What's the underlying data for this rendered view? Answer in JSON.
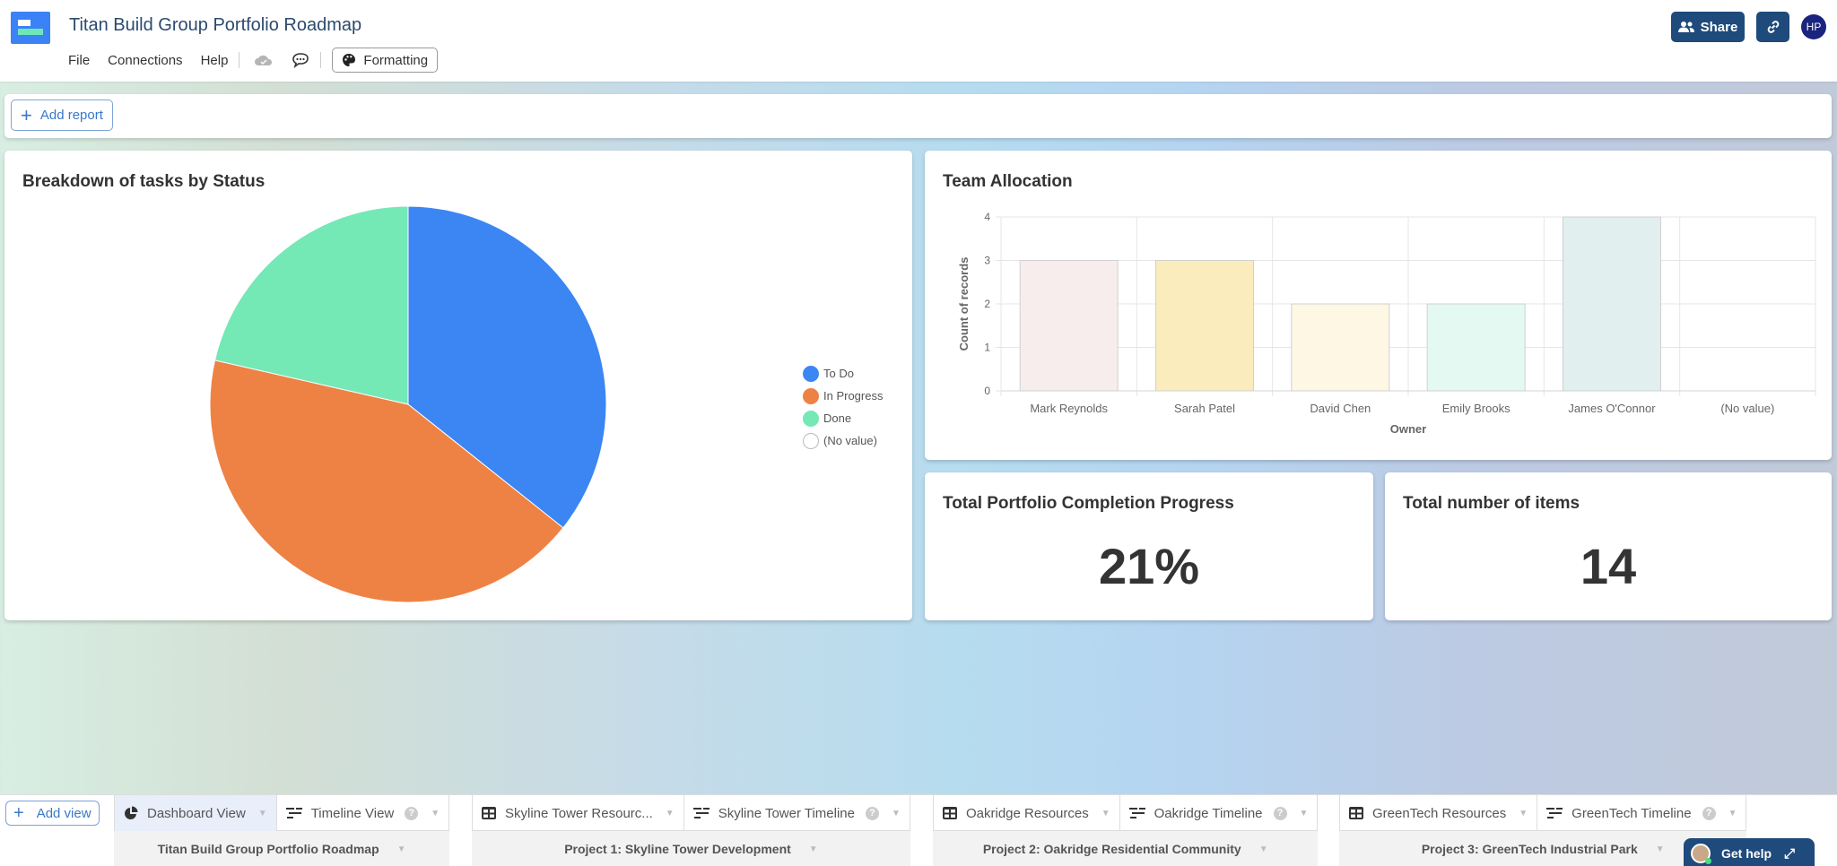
{
  "header": {
    "title": "Titan Build Group Portfolio Roadmap",
    "menu": [
      "File",
      "Connections",
      "Help"
    ],
    "formatting_label": "Formatting",
    "share_label": "Share",
    "avatar_initials": "HP"
  },
  "toolbar": {
    "add_report_label": "Add report"
  },
  "pie_card": {
    "title": "Breakdown of tasks by Status"
  },
  "bar_card": {
    "title": "Team Allocation"
  },
  "kpis": [
    {
      "title": "Total Portfolio Completion Progress",
      "value": "21%"
    },
    {
      "title": "Total number of items",
      "value": "14"
    }
  ],
  "chart_data": [
    {
      "type": "pie",
      "title": "Breakdown of tasks by Status",
      "categories": [
        "To Do",
        "In Progress",
        "Done",
        "(No value)"
      ],
      "values": [
        5,
        6,
        3,
        0
      ],
      "colors": [
        "#3b86f3",
        "#ee8244",
        "#74e8b5",
        "#ffffff"
      ],
      "legend": "right"
    },
    {
      "type": "bar",
      "title": "Team Allocation",
      "categories": [
        "Mark Reynolds",
        "Sarah Patel",
        "David Chen",
        "Emily Brooks",
        "James O'Connor",
        "(No value)"
      ],
      "values": [
        3,
        3,
        2,
        2,
        4,
        0
      ],
      "colors": [
        "#f8eded",
        "#fbecbd",
        "#fdf7e4",
        "#e4f9f1",
        "#e1f0ef",
        "#ffffff"
      ],
      "xlabel": "Owner",
      "ylabel": "Count of records",
      "ylim": [
        0,
        4
      ],
      "yticks": [
        "0",
        "1",
        "2",
        "3",
        "4"
      ],
      "grid": true
    }
  ],
  "bottom": {
    "add_view_label": "Add view",
    "groups": [
      {
        "label": "Titan Build Group Portfolio Roadmap",
        "tabs": [
          {
            "label": "Dashboard View",
            "icon": "pie-chart-icon",
            "active": true
          },
          {
            "label": "Timeline View",
            "icon": "timeline-icon",
            "help": true
          }
        ]
      },
      {
        "label": "Project 1: Skyline Tower Development",
        "tabs": [
          {
            "label": "Skyline Tower Resourc...",
            "icon": "grid-icon"
          },
          {
            "label": "Skyline Tower Timeline",
            "icon": "timeline-icon",
            "help": true
          }
        ]
      },
      {
        "label": "Project 2: Oakridge Residential Community",
        "tabs": [
          {
            "label": "Oakridge Resources",
            "icon": "grid-icon"
          },
          {
            "label": "Oakridge Timeline",
            "icon": "timeline-icon",
            "help": true
          }
        ]
      },
      {
        "label": "Project 3: GreenTech Industrial Park",
        "tabs": [
          {
            "label": "GreenTech Resources",
            "icon": "grid-icon"
          },
          {
            "label": "GreenTech Timeline",
            "icon": "timeline-icon",
            "help": true
          }
        ]
      }
    ],
    "get_help_label": "Get help",
    "help_glyph": "?"
  }
}
